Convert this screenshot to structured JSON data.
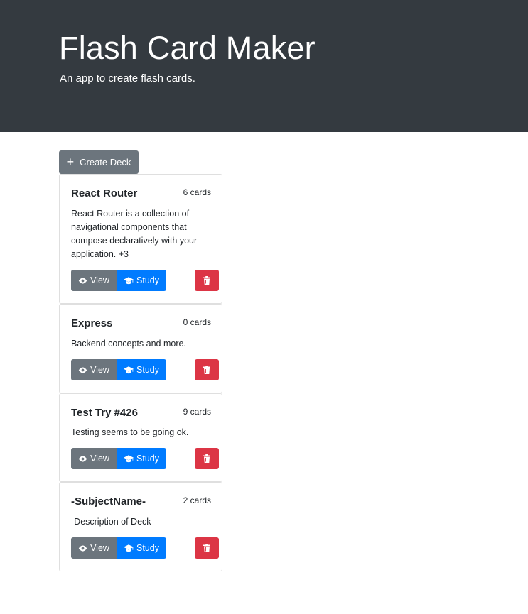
{
  "header": {
    "title": "Flash Card Maker",
    "subtitle": "An app to create flash cards."
  },
  "actions": {
    "create_deck_label": "Create Deck",
    "create_icon": "plus-icon"
  },
  "deck_buttons": {
    "view_label": "View",
    "study_label": "Study",
    "view_icon": "eye-icon",
    "study_icon": "graduation-cap-icon",
    "delete_icon": "trash-icon"
  },
  "decks": [
    {
      "name": "React Router",
      "count": "6 cards",
      "description": "React Router is a collection of navigational components that compose declaratively with your application. +3"
    },
    {
      "name": "Express",
      "count": "0 cards",
      "description": "Backend concepts and more."
    },
    {
      "name": "Test Try #426",
      "count": "9 cards",
      "description": "Testing seems to be going ok."
    },
    {
      "name": "-SubjectName-",
      "count": "2 cards",
      "description": "-Description of Deck-"
    }
  ],
  "colors": {
    "jumbotron": "#343a40",
    "secondary": "#6c757d",
    "primary": "#007bff",
    "danger": "#dc3545"
  }
}
